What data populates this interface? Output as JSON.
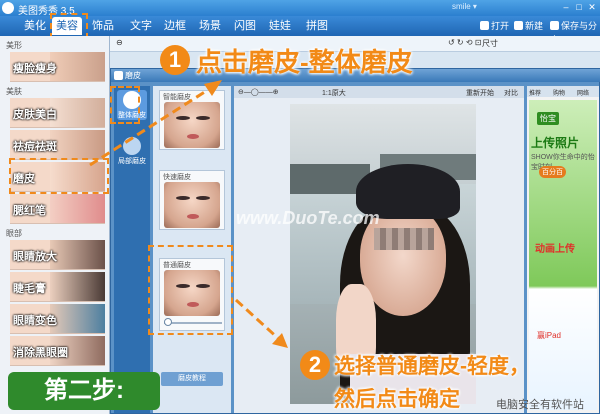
{
  "titlebar": {
    "app_title": "美图秀秀 3.5",
    "user": "smile ▾"
  },
  "tabs": [
    "美化",
    "美容",
    "饰品",
    "文字",
    "边框",
    "场景",
    "闪图",
    "娃娃",
    "拼图"
  ],
  "top_actions": {
    "open": "打开",
    "new": "新建",
    "save": "保存与分享"
  },
  "toolbar": {
    "size": "尺寸"
  },
  "sidebar": {
    "cat_shape": "美形",
    "cat_skin": "美肤",
    "cat_eye": "眼部",
    "items": [
      "瘦脸瘦身",
      "皮肤美白",
      "祛痘祛斑",
      "磨皮",
      "腮红笔",
      "眼睛放大",
      "睫毛膏",
      "眼睛变色",
      "消除黑眼圈"
    ]
  },
  "dialog": {
    "title": "磨皮",
    "modes": [
      "整体磨皮",
      "局部磨皮"
    ],
    "presets": [
      "智能磨皮",
      "快速磨皮",
      "普通磨皮"
    ],
    "compare_btn": "磨皮教程",
    "canvas_zoom": "1:1原大",
    "canvas_reset": "重新开始",
    "canvas_compare": "对比",
    "right_tabs": [
      "推荐",
      "购物",
      "网络"
    ],
    "ad": {
      "brand": "怡宝",
      "big": "上传照片",
      "show": "SHOW你生命中的怡宝时刻",
      "pill": "百分百",
      "t2": "动画上传",
      "t3": "赢iPad"
    }
  },
  "annotations": {
    "num1": "1",
    "text1": "点击磨皮-整体磨皮",
    "num2": "2",
    "text2a": "选择普通磨皮-轻度，",
    "text2b": "然后点击确定",
    "step": "第二步:",
    "watermark": "www.DuoTe.com",
    "footer": "电脑安全有软件站"
  }
}
